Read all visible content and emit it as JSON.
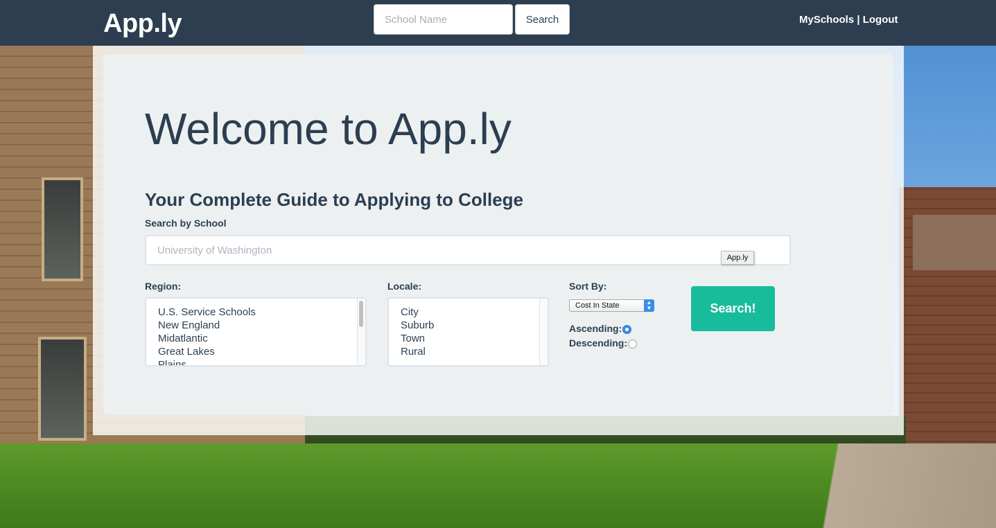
{
  "navbar": {
    "brand": "App.ly",
    "search_placeholder": "School Name",
    "search_button": "Search",
    "link_myschools": "MySchools",
    "separator": " | ",
    "link_logout": "Logout"
  },
  "main": {
    "title": "Welcome to App.ly",
    "subtitle": "Your Complete Guide to Applying to College",
    "search_label": "Search by School",
    "search_placeholder": "University of Washington",
    "tooltip": "App.ly",
    "region": {
      "label": "Region:",
      "options": [
        "U.S. Service Schools",
        "New England",
        "Midatlantic",
        "Great Lakes",
        "Plains"
      ]
    },
    "locale": {
      "label": "Locale:",
      "options": [
        "City",
        "Suburb",
        "Town",
        "Rural"
      ]
    },
    "sort": {
      "label": "Sort By:",
      "selected": "Cost In State",
      "ascending_label": "Ascending:",
      "ascending_checked": true,
      "descending_label": "Descending:",
      "descending_checked": false
    },
    "submit_button": "Search!"
  },
  "colors": {
    "navbar": "#2c3e50",
    "text": "#2c3e50",
    "panel": "#ecf0f1",
    "accent": "#18bc9c",
    "radio": "#3b8de7"
  }
}
